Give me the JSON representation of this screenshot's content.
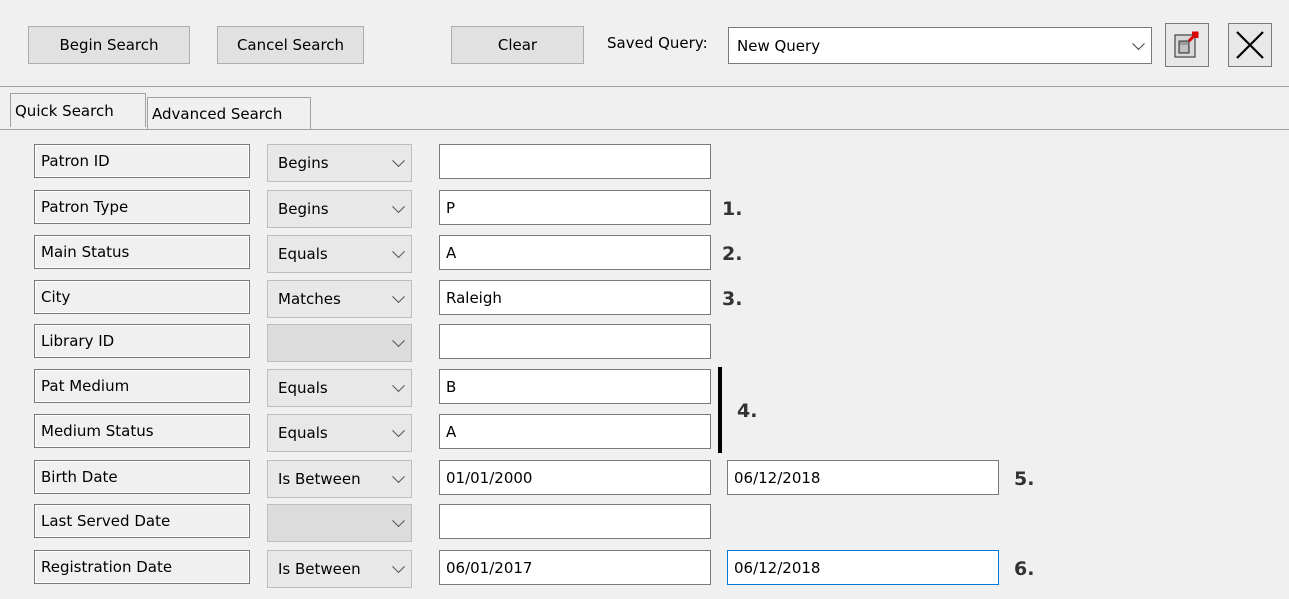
{
  "toolbar": {
    "begin_search": "Begin Search",
    "cancel_search": "Cancel Search",
    "clear": "Clear",
    "saved_query_label": "Saved Query:",
    "saved_query_value": "New Query",
    "icons": [
      "export-icon",
      "close-icon"
    ]
  },
  "tabs": [
    {
      "label": "Quick Search",
      "active": true
    },
    {
      "label": "Advanced Search",
      "active": false
    }
  ],
  "rows": [
    {
      "label": "Patron ID",
      "operator": "Begins",
      "value1": "",
      "value2": null,
      "note": ""
    },
    {
      "label": "Patron Type",
      "operator": "Begins",
      "value1": "P",
      "value2": null,
      "note": "1."
    },
    {
      "label": "Main Status",
      "operator": "Equals",
      "value1": "A",
      "value2": null,
      "note": "2."
    },
    {
      "label": "City",
      "operator": "Matches",
      "value1": "Raleigh",
      "value2": null,
      "note": "3."
    },
    {
      "label": "Library ID",
      "operator": "",
      "value1": "",
      "value2": null,
      "note": ""
    },
    {
      "label": "Pat Medium",
      "operator": "Equals",
      "value1": "B",
      "value2": null,
      "note": ""
    },
    {
      "label": "Medium Status",
      "operator": "Equals",
      "value1": "A",
      "value2": null,
      "note": ""
    },
    {
      "label": "Birth Date",
      "operator": "Is Between",
      "value1": "01/01/2000",
      "value2": "06/12/2018",
      "note": "5."
    },
    {
      "label": "Last Served Date",
      "operator": "",
      "value1": "",
      "value2": null,
      "note": ""
    },
    {
      "label": "Registration Date",
      "operator": "Is Between",
      "value1": "06/01/2017",
      "value2": "06/12/2018",
      "note": "6."
    }
  ],
  "bracket_note": "4."
}
